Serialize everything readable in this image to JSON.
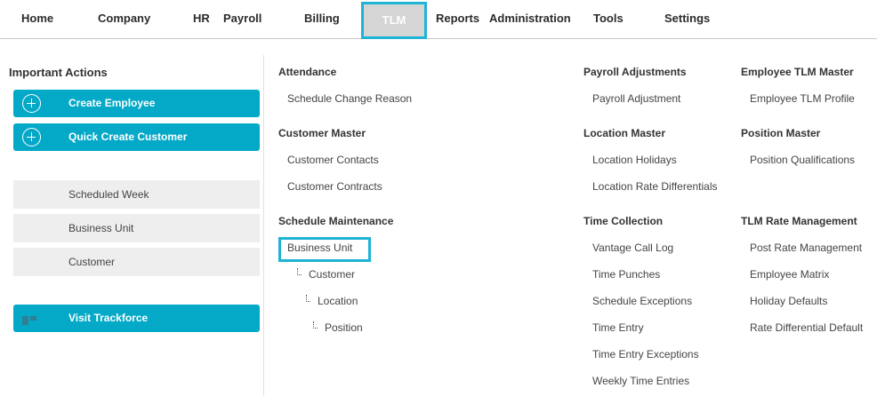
{
  "nav": {
    "home": "Home",
    "company": "Company",
    "hr": "HR",
    "payroll": "Payroll",
    "billing": "Billing",
    "tlm": "TLM",
    "reports": "Reports",
    "administration": "Administration",
    "tools": "Tools",
    "settings": "Settings"
  },
  "sidebar": {
    "title": "Important Actions",
    "create_employee": "Create Employee",
    "quick_create_customer": "Quick Create Customer",
    "scheduled_week": "Scheduled Week",
    "business_unit": "Business Unit",
    "customer": "Customer",
    "visit_trackforce": "Visit Trackforce"
  },
  "menu": {
    "attendance": {
      "heading": "Attendance",
      "schedule_change_reason": "Schedule Change Reason"
    },
    "customer_master": {
      "heading": "Customer Master",
      "customer_contacts": "Customer Contacts",
      "customer_contracts": "Customer Contracts"
    },
    "schedule_maintenance": {
      "heading": "Schedule Maintenance",
      "business_unit": "Business Unit",
      "customer": "Customer",
      "location": "Location",
      "position": "Position"
    },
    "payroll_adjustments": {
      "heading": "Payroll Adjustments",
      "payroll_adjustment": "Payroll Adjustment"
    },
    "location_master": {
      "heading": "Location Master",
      "location_holidays": "Location Holidays",
      "location_rate_differentials": "Location Rate Differentials"
    },
    "time_collection": {
      "heading": "Time Collection",
      "vantage_call_log": "Vantage Call Log",
      "time_punches": "Time Punches",
      "schedule_exceptions": "Schedule Exceptions",
      "time_entry": "Time Entry",
      "time_entry_exceptions": "Time Entry Exceptions",
      "weekly_time_entries": "Weekly Time Entries"
    },
    "employee_tlm_master": {
      "heading": "Employee TLM Master",
      "employee_tlm_profile": "Employee TLM Profile"
    },
    "position_master": {
      "heading": "Position Master",
      "position_qualifications": "Position Qualifications"
    },
    "tlm_rate_management": {
      "heading": "TLM Rate Management",
      "post_rate_management": "Post Rate Management",
      "employee_matrix": "Employee Matrix",
      "holiday_defaults": "Holiday Defaults",
      "rate_differential_default": "Rate Differential Default"
    }
  },
  "colors": {
    "accent": "#04a9c7",
    "highlight": "#1fb3d6",
    "active_tab_bg": "#d5d5d5",
    "button_gray": "#eeeeef"
  }
}
